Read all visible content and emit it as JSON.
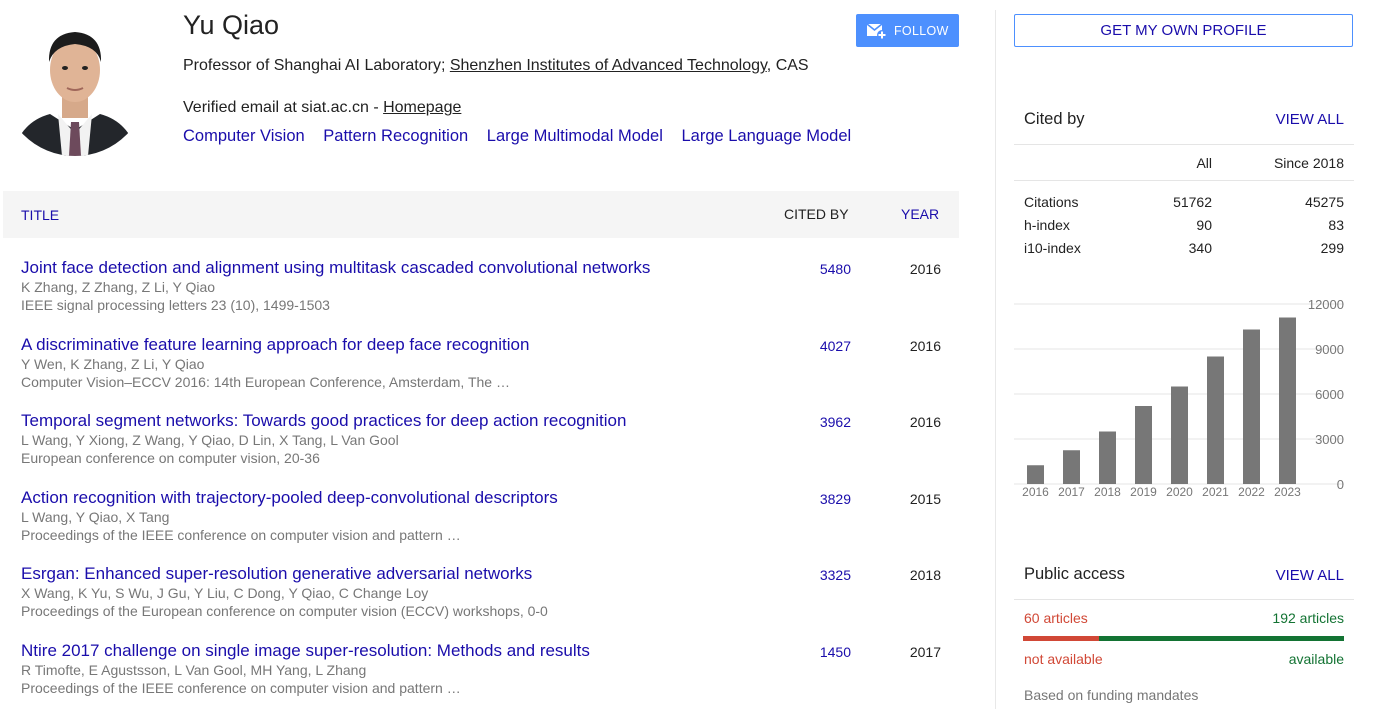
{
  "profile": {
    "name": "Yu Qiao",
    "affiliation_prefix": "Professor of Shanghai AI Laboratory; ",
    "affiliation_link": "Shenzhen Institutes of Advanced Technology",
    "affiliation_suffix": ", CAS",
    "email_text": "Verified email at siat.ac.cn - ",
    "homepage_label": "Homepage",
    "interests": [
      "Computer Vision",
      "Pattern Recognition",
      "Large Multimodal Model",
      "Large Language Model"
    ],
    "follow_label": "FOLLOW"
  },
  "table": {
    "col_title": "TITLE",
    "col_cited": "CITED BY",
    "col_year": "YEAR",
    "rows": [
      {
        "title": "Joint face detection and alignment using multitask cascaded convolutional networks",
        "authors": "K Zhang, Z Zhang, Z Li, Y Qiao",
        "venue": "IEEE signal processing letters 23 (10), 1499-1503",
        "cited": "5480",
        "year": "2016"
      },
      {
        "title": "A discriminative feature learning approach for deep face recognition",
        "authors": "Y Wen, K Zhang, Z Li, Y Qiao",
        "venue": "Computer Vision–ECCV 2016: 14th European Conference, Amsterdam, The …",
        "cited": "4027",
        "year": "2016"
      },
      {
        "title": "Temporal segment networks: Towards good practices for deep action recognition",
        "authors": "L Wang, Y Xiong, Z Wang, Y Qiao, D Lin, X Tang, L Van Gool",
        "venue": "European conference on computer vision, 20-36",
        "cited": "3962",
        "year": "2016"
      },
      {
        "title": "Action recognition with trajectory-pooled deep-convolutional descriptors",
        "authors": "L Wang, Y Qiao, X Tang",
        "venue": "Proceedings of the IEEE conference on computer vision and pattern …",
        "cited": "3829",
        "year": "2015"
      },
      {
        "title": "Esrgan: Enhanced super-resolution generative adversarial networks",
        "authors": "X Wang, K Yu, S Wu, J Gu, Y Liu, C Dong, Y Qiao, C Change Loy",
        "venue": "Proceedings of the European conference on computer vision (ECCV) workshops, 0-0",
        "cited": "3325",
        "year": "2018"
      },
      {
        "title": "Ntire 2017 challenge on single image super-resolution: Methods and results",
        "authors": "R Timofte, E Agustsson, L Van Gool, MH Yang, L Zhang",
        "venue": "Proceedings of the IEEE conference on computer vision and pattern …",
        "cited": "1450",
        "year": "2017"
      }
    ]
  },
  "sidebar": {
    "get_profile_label": "GET MY OWN PROFILE",
    "cited_by": {
      "heading": "Cited by",
      "view_all": "VIEW ALL",
      "col_all": "All",
      "col_since": "Since 2018",
      "stats": [
        {
          "label": "Citations",
          "all": "51762",
          "since": "45275"
        },
        {
          "label": "h-index",
          "all": "90",
          "since": "83"
        },
        {
          "label": "i10-index",
          "all": "340",
          "since": "299"
        }
      ]
    },
    "public_access": {
      "heading": "Public access",
      "view_all": "VIEW ALL",
      "not_available_count": "60 articles",
      "available_count": "192 articles",
      "not_available_label": "not available",
      "available_label": "available",
      "available_fraction": 0.762,
      "footnote": "Based on funding mandates"
    }
  },
  "chart_data": {
    "type": "bar",
    "categories": [
      "2016",
      "2017",
      "2018",
      "2019",
      "2020",
      "2021",
      "2022",
      "2023"
    ],
    "values": [
      1250,
      2250,
      3500,
      5200,
      6500,
      8500,
      10300,
      11100
    ],
    "yticks": [
      "0",
      "3000",
      "6000",
      "9000",
      "12000"
    ],
    "ylim": [
      0,
      12000
    ],
    "bar_color": "#777777",
    "grid": true
  },
  "colors": {
    "link": "#1a0dab",
    "follow_button": "#4d90fe",
    "not_available": "#d14836",
    "available": "#137333"
  }
}
